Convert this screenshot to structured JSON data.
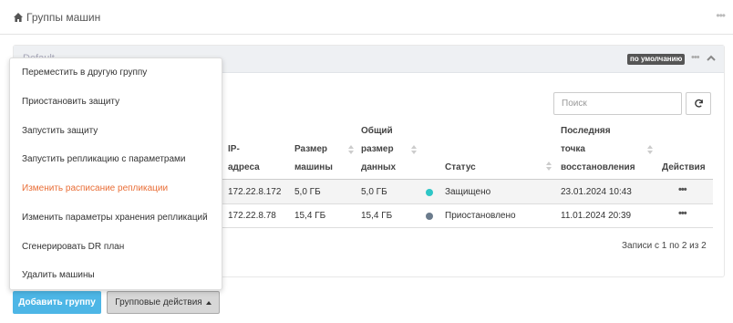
{
  "page": {
    "title": "Группы машин"
  },
  "panel": {
    "header_ghost": "Default",
    "badge": "по умолчанию"
  },
  "search": {
    "placeholder": "Поиск"
  },
  "table": {
    "columns": {
      "ip": [
        "IP-",
        "адреса"
      ],
      "size": [
        "Размер",
        "машины"
      ],
      "data": [
        "Общий",
        "размер",
        "данных"
      ],
      "status": [
        "Статус"
      ],
      "last": [
        "Последняя",
        "точка",
        "восстановления"
      ],
      "actions": [
        "Действия"
      ]
    },
    "rows": [
      {
        "ip": "172.22.8.172",
        "size": "5,0 ГБ",
        "data": "5,0 ГБ",
        "status": "Защищено",
        "status_color": "#2ec6c6",
        "last": "23.01.2024 10:43",
        "actions": "•••"
      },
      {
        "ip": "172.22.8.78",
        "size": "15,4 ГБ",
        "data": "15,4 ГБ",
        "status": "Приостановлено",
        "status_color": "#6b7b8c",
        "last": "11.01.2024 20:39",
        "actions": "•••"
      }
    ],
    "records_text": "Записи с 1 по 2 из 2"
  },
  "buttons": {
    "add_group": "Добавить группу",
    "group_actions": "Групповые действия"
  },
  "menu": {
    "items": [
      "Переместить в другую группу",
      "Приостановить защиту",
      "Запустить защиту",
      "Запустить репликацию с параметрами",
      "Изменить расписание репликации",
      "Изменить параметры хранения репликаций",
      "Сгенерировать DR план",
      "Удалить машины"
    ],
    "active_index": 4
  },
  "colors": {
    "accent": "#4db6e6",
    "menu_active": "#e96e37",
    "panel_head": "#eef0f3"
  },
  "icons": {
    "home": "home-icon",
    "refresh": "refresh-icon",
    "collapse": "chevron-up-icon",
    "more": "more-dots-icon"
  }
}
